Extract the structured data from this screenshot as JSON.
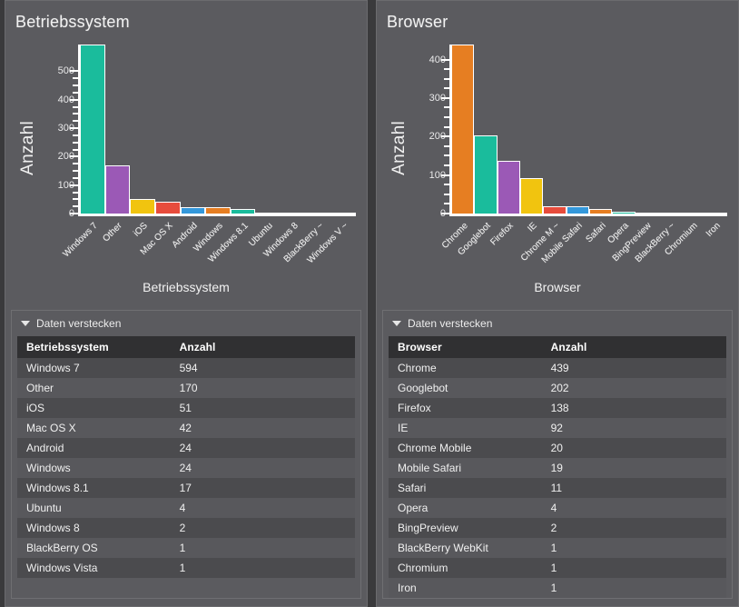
{
  "panels": [
    {
      "chart_title": "Betriebssystem",
      "chart_caption": "Betriebssystem",
      "ylabel": "Anzahl",
      "toggle_label": "Daten verstecken",
      "columns": [
        "Betriebssystem",
        "Anzahl"
      ],
      "rows": [
        [
          "Windows 7",
          "594"
        ],
        [
          "Other",
          "170"
        ],
        [
          "iOS",
          "51"
        ],
        [
          "Mac OS X",
          "42"
        ],
        [
          "Android",
          "24"
        ],
        [
          "Windows",
          "24"
        ],
        [
          "Windows 8.1",
          "17"
        ],
        [
          "Ubuntu",
          "4"
        ],
        [
          "Windows 8",
          "2"
        ],
        [
          "BlackBerry OS",
          "1"
        ],
        [
          "Windows Vista",
          "1"
        ]
      ]
    },
    {
      "chart_title": "Browser",
      "chart_caption": "Browser",
      "ylabel": "Anzahl",
      "toggle_label": "Daten verstecken",
      "columns": [
        "Browser",
        "Anzahl"
      ],
      "rows": [
        [
          "Chrome",
          "439"
        ],
        [
          "Googlebot",
          "202"
        ],
        [
          "Firefox",
          "138"
        ],
        [
          "IE",
          "92"
        ],
        [
          "Chrome Mobile",
          "20"
        ],
        [
          "Mobile Safari",
          "19"
        ],
        [
          "Safari",
          "11"
        ],
        [
          "Opera",
          "4"
        ],
        [
          "BingPreview",
          "2"
        ],
        [
          "BlackBerry WebKit",
          "1"
        ],
        [
          "Chromium",
          "1"
        ],
        [
          "Iron",
          "1"
        ]
      ]
    }
  ],
  "palette": [
    "#1abc9c",
    "#9b59b6",
    "#f1c40f",
    "#e74c3c",
    "#3498db",
    "#e67e22"
  ],
  "chart_data": [
    {
      "type": "bar",
      "title": "Betriebssystem",
      "xlabel": "",
      "ylabel": "Anzahl",
      "ylim": [
        0,
        594
      ],
      "yticks": [
        0,
        100,
        200,
        300,
        400,
        500
      ],
      "grid": false,
      "legend": "none",
      "categories": [
        "Windows 7",
        "Other",
        "iOS",
        "Mac OS X",
        "Android",
        "Windows",
        "Windows 8.1",
        "Ubuntu",
        "Windows 8",
        "BlackBerry ...",
        "Windows V..."
      ],
      "tick_labels": [
        "Windows 7",
        "Other",
        "iOS",
        "Mac OS X",
        "Android",
        "Windows",
        "Windows 8.1",
        "Ubuntu",
        "Windows 8",
        "BlackBerry ~",
        "Windows V ~"
      ],
      "values": [
        594,
        170,
        51,
        42,
        24,
        24,
        17,
        4,
        2,
        1,
        1
      ],
      "bar_colors": [
        "#1abc9c",
        "#9b59b6",
        "#f1c40f",
        "#e74c3c",
        "#3498db",
        "#e67e22",
        "#1abc9c",
        "#9b59b6",
        "#f1c40f",
        "#e74c3c",
        "#3498db"
      ]
    },
    {
      "type": "bar",
      "title": "Browser",
      "xlabel": "",
      "ylabel": "Anzahl",
      "ylim": [
        0,
        439
      ],
      "yticks": [
        0,
        100,
        200,
        300,
        400
      ],
      "grid": false,
      "legend": "none",
      "categories": [
        "Chrome",
        "Googlebot",
        "Firefox",
        "IE",
        "Chrome Mobile",
        "Mobile Safari",
        "Safari",
        "Opera",
        "BingPreview",
        "BlackBerry WebKit",
        "Chromium",
        "Iron"
      ],
      "tick_labels": [
        "Chrome",
        "Googlebot",
        "Firefox",
        "IE",
        "Chrome M ~",
        "Mobile Safari",
        "Safari",
        "Opera",
        "BingPreview",
        "BlackBerry ~",
        "Chromium",
        "Iron"
      ],
      "values": [
        439,
        202,
        138,
        92,
        20,
        19,
        11,
        4,
        2,
        1,
        1,
        1
      ],
      "bar_colors": [
        "#e67e22",
        "#1abc9c",
        "#9b59b6",
        "#f1c40f",
        "#e74c3c",
        "#3498db",
        "#e67e22",
        "#1abc9c",
        "#9b59b6",
        "#f1c40f",
        "#e74c3c",
        "#3498db"
      ]
    }
  ]
}
